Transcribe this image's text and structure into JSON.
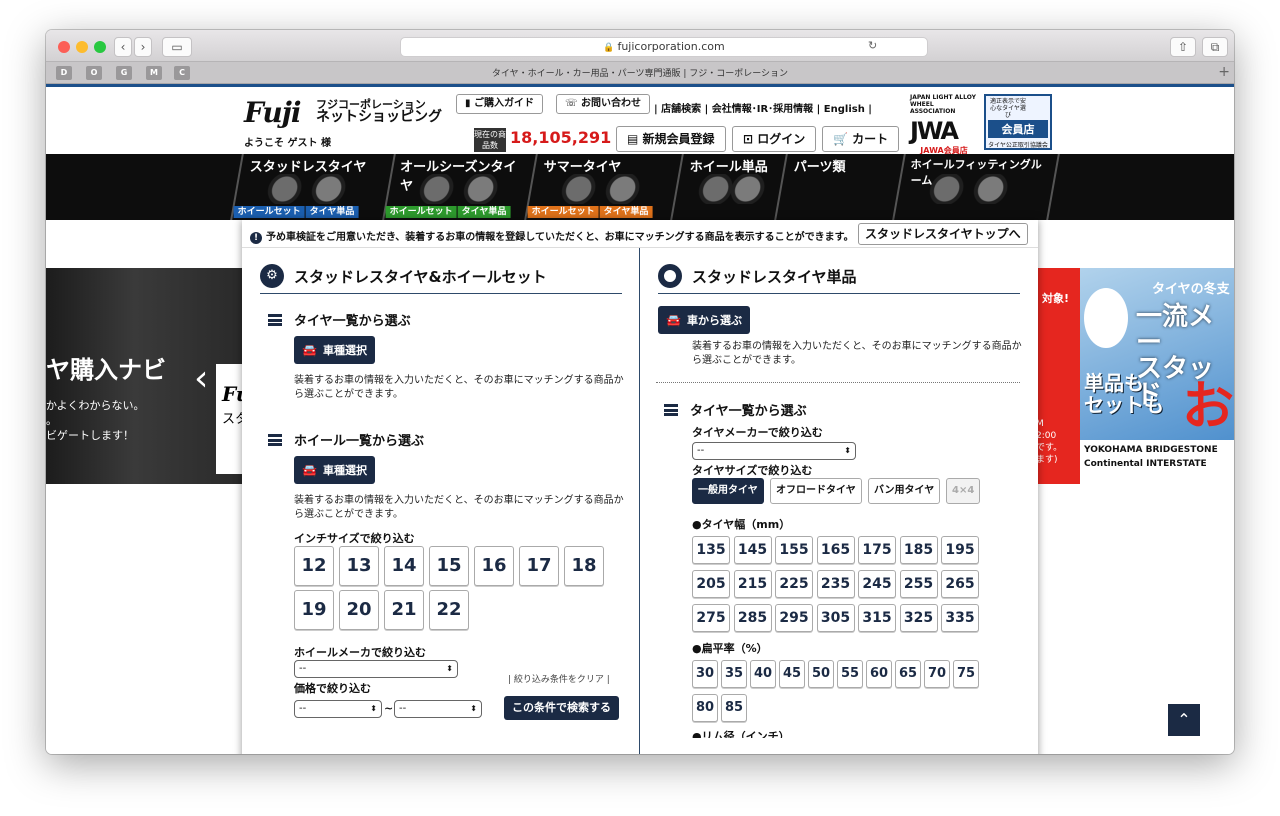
{
  "browser": {
    "url": "fujicorporation.com",
    "tab_title": "タイヤ・ホイール・カー用品・パーツ専門通販 | フジ・コーポレーション",
    "favorites": [
      "D",
      "O",
      "G",
      "M",
      "C"
    ]
  },
  "header": {
    "logo": "Fuji",
    "logo_sub1": "フジコーポレーション",
    "logo_sub2": "ネットショッピング",
    "welcome": "ようこそ ゲスト 様",
    "guide_button": "ご購入ガイド",
    "contact_button": "お問い合わせ",
    "links": "| 店舗検索 | 会社情報･IR･採用情報 | English |",
    "count_label": "現在の商品数",
    "count_value": "18,105,291",
    "count_unit": "点",
    "register_button": "新規会員登録",
    "login_button": "ログイン",
    "cart_button": "カート",
    "jawa_small": "JAPAN LIGHT ALLOY WHEEL ASSOCIATION",
    "jawa_member": "JAWA会員店",
    "member_store": "会員店",
    "member_small": "適正表示で安心なタイヤ選び",
    "member_foot": "タイヤ公正取引協議会"
  },
  "categories": [
    {
      "label": "スタッドレスタイヤ",
      "tag1": "ホイールセット",
      "tag2": "タイヤ単品"
    },
    {
      "label": "オールシーズンタイヤ",
      "tag1": "ホイールセット",
      "tag2": "タイヤ単品"
    },
    {
      "label": "サマータイヤ",
      "tag1": "ホイールセット",
      "tag2": "タイヤ単品"
    },
    {
      "label": "ホイール単品"
    },
    {
      "label": "パーツ類"
    },
    {
      "label": "ホイールフィッティングルーム"
    }
  ],
  "notice": {
    "text": "予め車検証をご用意いただき、装着するお車の情報を登録していただくと、お車にマッチングする商品を表示することができます。",
    "top_button": "スタッドレスタイヤトップへ"
  },
  "banner_left": {
    "title": "ヤ購入ナビ",
    "line1": "かよくわからない。",
    "line2": "。",
    "line3": "ビゲートします！",
    "card_logo": "Fu",
    "card_sub": "スタ"
  },
  "banner_right": {
    "red_text": "対象!",
    "caption": "タイヤの冬支",
    "big1": "一流メー",
    "big2": "スタッド",
    "tanpin": "単品も",
    "set": "セットも",
    "o": "お",
    "small1": "M",
    "small2": "2:00",
    "small3": "です。",
    "small4": "ます)",
    "brand1": "YOKOHAMA  BRIDGESTONE",
    "brand2": "Continental  INTERSTATE"
  },
  "left": {
    "title": "スタッドレスタイヤ&ホイールセット",
    "sec1": "タイヤ一覧から選ぶ",
    "car_button": "車種選択",
    "desc": "装着するお車の情報を入力いただくと、そのお車にマッチングする商品から選ぶことができます。",
    "sec2": "ホイール一覧から選ぶ",
    "inch_label": "インチサイズで絞り込む",
    "inches": [
      "12",
      "13",
      "14",
      "15",
      "16",
      "17",
      "18",
      "19",
      "20",
      "21",
      "22"
    ],
    "wheel_maker_label": "ホイールメーカで絞り込む",
    "select_default": "--",
    "clear": "| 絞り込み条件をクリア |",
    "price_label": "価格で絞り込む",
    "tilde": "~",
    "search_button": "この条件で検索する"
  },
  "right": {
    "title": "スタッドレスタイヤ単品",
    "car_button": "車から選ぶ",
    "desc": "装着するお車の情報を入力いただくと、そのお車にマッチングする商品から選ぶことができます。",
    "sec": "タイヤ一覧から選ぶ",
    "maker_label": "タイヤメーカーで絞り込む",
    "select_default": "--",
    "size_label": "タイヤサイズで絞り込む",
    "tabs": [
      "一般用タイヤ",
      "オフロードタイヤ",
      "バン用タイヤ",
      "4×4"
    ],
    "width_label": "●タイヤ幅（mm）",
    "widths": [
      "135",
      "145",
      "155",
      "165",
      "175",
      "185",
      "195",
      "205",
      "215",
      "225",
      "235",
      "245",
      "255",
      "265",
      "275",
      "285",
      "295",
      "305",
      "315",
      "325",
      "335"
    ],
    "ratio_label": "●扁平率（%）",
    "ratios": [
      "30",
      "35",
      "40",
      "45",
      "50",
      "55",
      "60",
      "65",
      "70",
      "75",
      "80",
      "85"
    ],
    "rim_label": "●リム径（インチ）"
  }
}
